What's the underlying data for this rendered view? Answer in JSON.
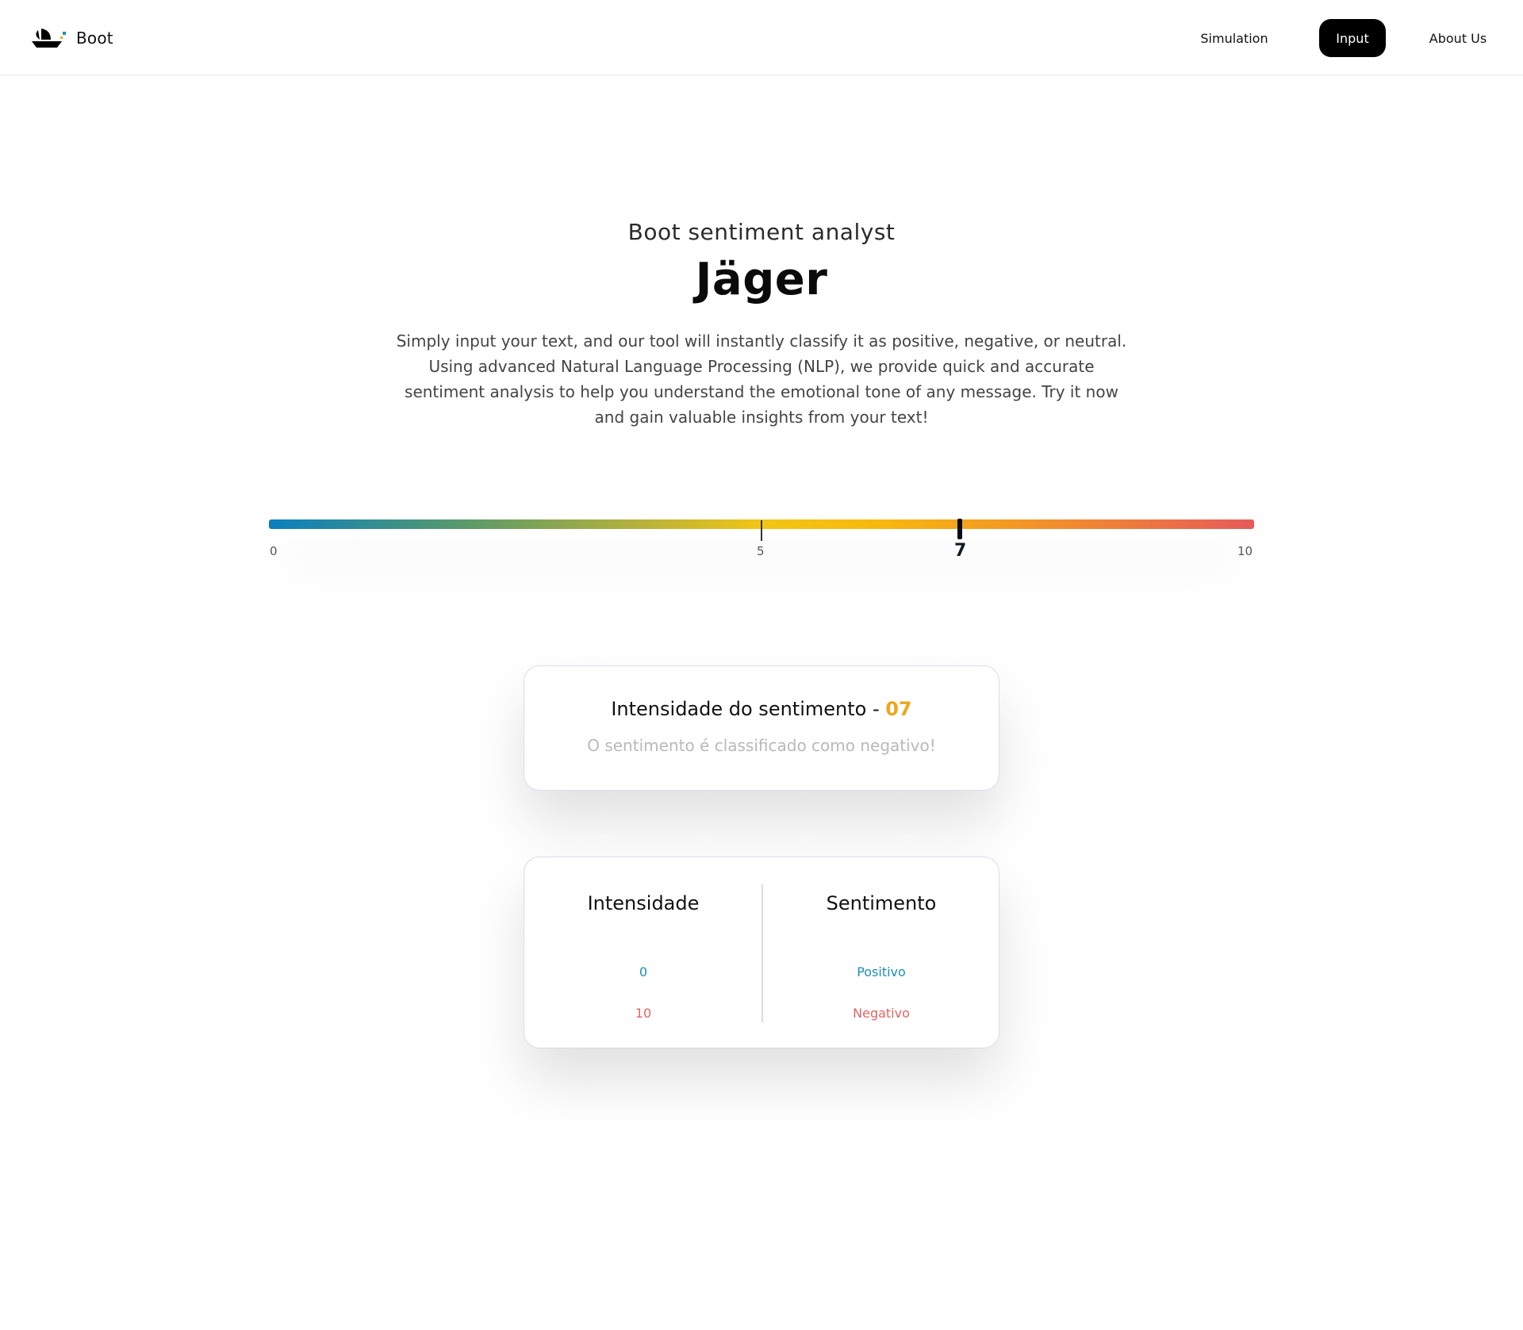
{
  "header": {
    "brand_name": "Boot",
    "nav": [
      {
        "label": "Simulation"
      },
      {
        "label": "Input",
        "active": true
      },
      {
        "label": "About Us"
      }
    ]
  },
  "hero": {
    "subtitle": "Boot sentiment analyst",
    "title": "Jäger",
    "description": "Simply input your text, and our tool will instantly classify it as positive, negative, or neutral. Using advanced Natural Language Processing (NLP), we provide quick and accurate sentiment analysis to help you understand the emotional tone of any message. Try it now and gain valuable insights from your text!"
  },
  "gauge": {
    "min_label": "0",
    "mid_label": "5",
    "max_label": "10",
    "current_label": "7",
    "min": 0,
    "max": 10,
    "mid": 5,
    "value": 7,
    "colors": [
      "#0a7fbf",
      "#f2c514",
      "#f28d2c",
      "#e75a5a"
    ]
  },
  "result": {
    "title_prefix": "Intensidade do sentimento - ",
    "score": "07",
    "classification": "O sentimento é classificado como negativo!",
    "score_color": "#f0a41c"
  },
  "legend": {
    "col1_header": "Intensidade",
    "col2_header": "Sentimento",
    "rows": [
      {
        "intensity": "0",
        "sentiment": "Positivo",
        "color": "#1c8fb8"
      },
      {
        "intensity": "10",
        "sentiment": "Negativo",
        "color": "#e06565"
      }
    ]
  }
}
